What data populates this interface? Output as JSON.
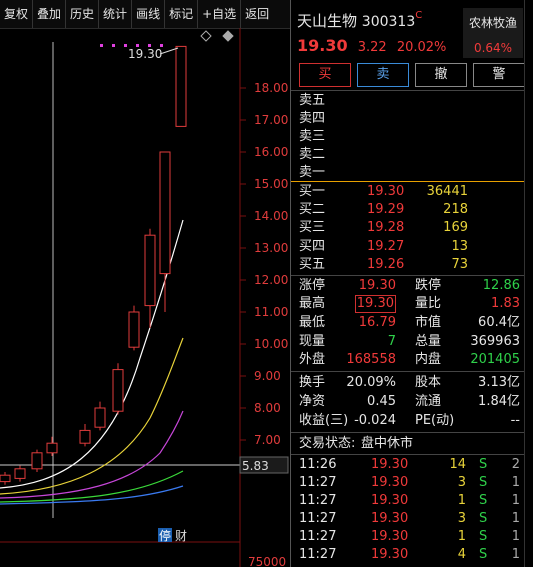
{
  "toolbar": {
    "items": [
      "复权",
      "叠加",
      "历史",
      "统计",
      "画线",
      "标记",
      "+自选",
      "返回"
    ]
  },
  "stock": {
    "name": "天山生物",
    "code": "300313",
    "code_badge": "C",
    "price": "19.30",
    "change": "3.22",
    "change_pct": "20.02%",
    "sector": "农林牧渔",
    "sector_pct": "0.64%"
  },
  "actions": {
    "buy": "买",
    "sell": "卖",
    "cancel": "撤",
    "alert": "警"
  },
  "asks": [
    {
      "label": "卖五",
      "price": "",
      "vol": ""
    },
    {
      "label": "卖四",
      "price": "",
      "vol": ""
    },
    {
      "label": "卖三",
      "price": "",
      "vol": ""
    },
    {
      "label": "卖二",
      "price": "",
      "vol": ""
    },
    {
      "label": "卖一",
      "price": "",
      "vol": ""
    }
  ],
  "bids": [
    {
      "label": "买一",
      "price": "19.30",
      "vol": "36441"
    },
    {
      "label": "买二",
      "price": "19.29",
      "vol": "218"
    },
    {
      "label": "买三",
      "price": "19.28",
      "vol": "169"
    },
    {
      "label": "买四",
      "price": "19.27",
      "vol": "13"
    },
    {
      "label": "买五",
      "price": "19.26",
      "vol": "73"
    }
  ],
  "stats": {
    "limit_up_label": "涨停",
    "limit_up": "19.30",
    "limit_down_label": "跌停",
    "limit_down": "12.86",
    "high_label": "最高",
    "high": "19.30",
    "vol_ratio_label": "量比",
    "vol_ratio": "1.83",
    "low_label": "最低",
    "low": "16.79",
    "mktcap_label": "市值",
    "mktcap": "60.4亿",
    "last_label": "现量",
    "last": "7",
    "total_label": "总量",
    "total": "369963",
    "outer_label": "外盘",
    "outer": "168558",
    "inner_label": "内盘",
    "inner": "201405",
    "turnover_label": "换手",
    "turnover": "20.09%",
    "shares_label": "股本",
    "shares": "3.13亿",
    "nav_label": "净资",
    "nav": "0.45",
    "float_label": "流通",
    "float": "1.84亿",
    "eps_label": "收益(三)",
    "eps": "-0.024",
    "pe_label": "PE(动)",
    "pe": "--"
  },
  "status": {
    "label": "交易状态:",
    "value": "盘中休市"
  },
  "trades": [
    {
      "time": "11:26",
      "price": "19.30",
      "vol": "14",
      "side": "S",
      "n": "2"
    },
    {
      "time": "11:27",
      "price": "19.30",
      "vol": "3",
      "side": "S",
      "n": "1"
    },
    {
      "time": "11:27",
      "price": "19.30",
      "vol": "1",
      "side": "S",
      "n": "1"
    },
    {
      "time": "11:27",
      "price": "19.30",
      "vol": "3",
      "side": "S",
      "n": "1"
    },
    {
      "time": "11:27",
      "price": "19.30",
      "vol": "1",
      "side": "S",
      "n": "1"
    },
    {
      "time": "11:27",
      "price": "19.30",
      "vol": "4",
      "side": "S",
      "n": "1"
    }
  ],
  "chart_data": {
    "type": "candlestick",
    "price_ticks": [
      "18.00",
      "17.00",
      "16.00",
      "15.00",
      "14.00",
      "13.00",
      "12.00",
      "11.00",
      "10.00",
      "9.00",
      "8.00",
      "7.00"
    ],
    "high_marker": "19.30",
    "current_marker": "5.83",
    "volume_label": "75000",
    "badge_stop": "停",
    "badge_fin": "财",
    "candles": [
      {
        "o": 5.7,
        "c": 5.9,
        "h": 6.0,
        "l": 5.6
      },
      {
        "o": 5.8,
        "c": 6.1,
        "h": 6.2,
        "l": 5.7
      },
      {
        "o": 6.1,
        "c": 6.6,
        "h": 6.7,
        "l": 6.0
      },
      {
        "o": 6.6,
        "c": 6.9,
        "h": 7.1,
        "l": 6.5
      },
      {
        "o": 6.9,
        "c": 7.3,
        "h": 7.5,
        "l": 6.8
      },
      {
        "o": 7.4,
        "c": 8.0,
        "h": 8.2,
        "l": 7.3
      },
      {
        "o": 7.9,
        "c": 9.2,
        "h": 9.4,
        "l": 7.8
      },
      {
        "o": 9.9,
        "c": 11.0,
        "h": 11.2,
        "l": 9.8
      },
      {
        "o": 11.2,
        "c": 13.4,
        "h": 13.6,
        "l": 10.5
      },
      {
        "o": 12.2,
        "c": 16.0,
        "h": 16.0,
        "l": 11.0
      },
      {
        "o": 16.8,
        "c": 19.3,
        "h": 19.3,
        "l": 16.8
      }
    ]
  }
}
